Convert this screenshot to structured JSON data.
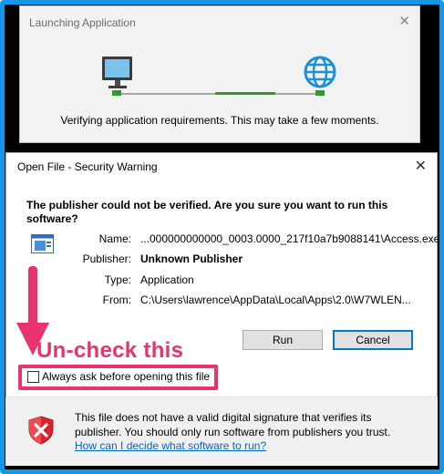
{
  "launch_window": {
    "title": "Launching Application",
    "message": "Verifying application requirements. This may take a few moments."
  },
  "dialog": {
    "title": "Open File - Security Warning",
    "question": "The publisher could not be verified.  Are you sure you want to run this software?",
    "fields": [
      {
        "label": "Name:",
        "value": "...000000000000_0003.0000_217f10a7b9088141\\Access.exe"
      },
      {
        "label": "Publisher:",
        "value": "Unknown Publisher"
      },
      {
        "label": "Type:",
        "value": "Application"
      },
      {
        "label": "From:",
        "value": "C:\\Users\\lawrence\\AppData\\Local\\Apps\\2.0\\W7WLEN..."
      }
    ],
    "run_label": "Run",
    "cancel_label": "Cancel",
    "checkbox_label": "Always ask before opening this file",
    "checkbox_checked": false,
    "footer_text": "This file does not have a valid digital signature that verifies its publisher.  You should only run software from publishers you trust.",
    "footer_link": "How can I decide what software to run?"
  },
  "annotation": {
    "text": "Un-check this",
    "color": "#e8336d"
  },
  "colors": {
    "frame_border": "#1596e6",
    "progress_green": "#2a9d2a",
    "globe_blue": "#1e90d6"
  }
}
